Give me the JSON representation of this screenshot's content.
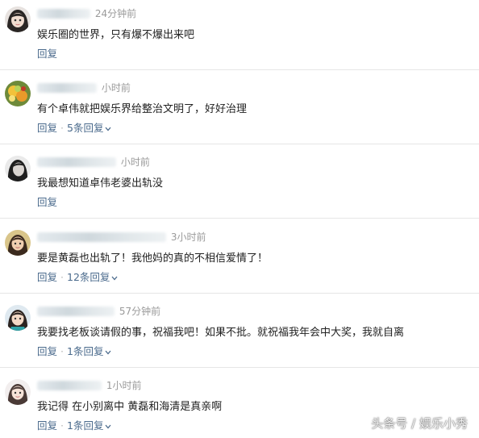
{
  "comments": [
    {
      "time": "24分钟前",
      "text": "娱乐圈的世界，只有爆不爆出来吧",
      "reply_label": "回复",
      "replies_label": ""
    },
    {
      "time": "小时前",
      "text": "有个卓伟就把娱乐界给整治文明了，好好治理",
      "reply_label": "回复",
      "replies_label": "5条回复"
    },
    {
      "time": "小时前",
      "text": "我最想知道卓伟老婆出轨没",
      "reply_label": "回复",
      "replies_label": ""
    },
    {
      "time": "3小时前",
      "text": "要是黄磊也出轨了！我他妈的真的不相信爱情了！",
      "reply_label": "回复",
      "replies_label": "12条回复"
    },
    {
      "time": "57分钟前",
      "text": "我要找老板谈请假的事，祝福我吧！如果不批。就祝福我年会中大奖，我就自离",
      "reply_label": "回复",
      "replies_label": "1条回复"
    },
    {
      "time": "1小时前",
      "text": "我记得 在小别离中 黄磊和海清是真亲啊",
      "reply_label": "回复",
      "replies_label": "1条回复"
    }
  ],
  "watermark": "头条号 / 娱乐小秀",
  "colors": {
    "link": "#4a6a8c",
    "meta": "#9a9a9a",
    "text": "#222222",
    "divider": "#e6e6e6"
  }
}
